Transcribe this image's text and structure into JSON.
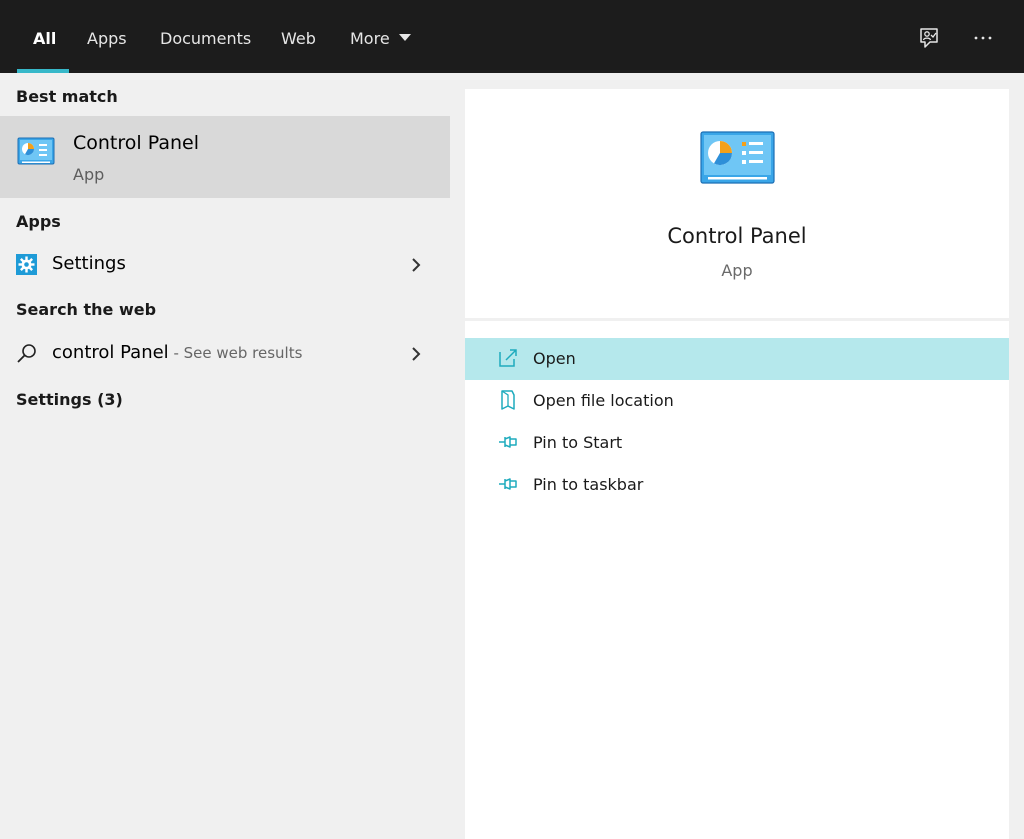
{
  "top_bar": {
    "tabs": [
      {
        "label": "All"
      },
      {
        "label": "Apps"
      },
      {
        "label": "Documents"
      },
      {
        "label": "Web"
      },
      {
        "label": "More"
      }
    ],
    "icons": [
      "feedback-icon",
      "more-options-icon"
    ]
  },
  "left": {
    "best_match_header": "Best match",
    "best_match": {
      "title": "Control Panel",
      "subtitle": "App",
      "icon": "control-panel-icon"
    },
    "apps_header": "Apps",
    "apps": [
      {
        "label": "Settings",
        "icon": "settings-gear-icon"
      }
    ],
    "web_header": "Search the web",
    "web_result": {
      "query": "control Panel",
      "hint": " - See web results",
      "icon": "search-icon"
    },
    "settings_header": "Settings (3)"
  },
  "right": {
    "app_name": "Control Panel",
    "app_type": "App",
    "actions": [
      {
        "label": "Open",
        "icon": "open-icon"
      },
      {
        "label": "Open file location",
        "icon": "file-location-icon"
      },
      {
        "label": "Pin to Start",
        "icon": "pin-icon"
      },
      {
        "label": "Pin to taskbar",
        "icon": "pin-icon"
      }
    ]
  },
  "colors": {
    "accent": "#37b8c9",
    "selected_action_bg": "#b5e8ec",
    "best_match_bg": "#d9d9d9",
    "topbar_bg": "#1c1c1c"
  }
}
